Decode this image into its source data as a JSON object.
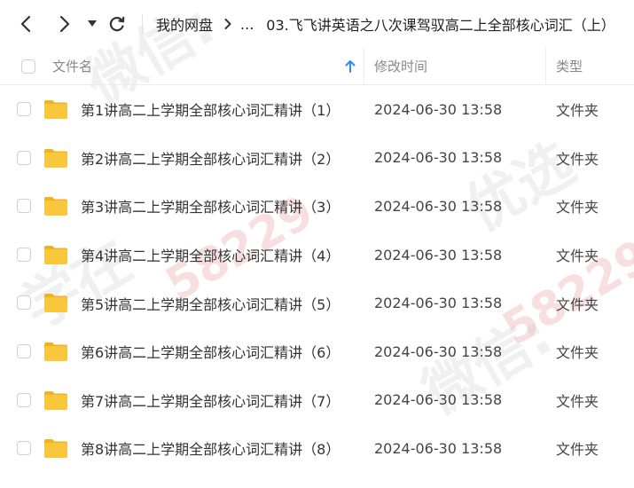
{
  "breadcrumb": {
    "root": "我的网盘",
    "ellipsis": "...",
    "current": "03.飞飞讲英语之八次课驾驭高二上全部核心词汇（上）"
  },
  "columns": {
    "name": "文件名",
    "modified": "修改时间",
    "type": "类型"
  },
  "files": [
    {
      "name": "第1讲高二上学期全部核心词汇精讲（1）",
      "modified": "2024-06-30 13:58",
      "type": "文件夹"
    },
    {
      "name": "第2讲高二上学期全部核心词汇精讲（2）",
      "modified": "2024-06-30 13:58",
      "type": "文件夹"
    },
    {
      "name": "第3讲高二上学期全部核心词汇精讲（3）",
      "modified": "2024-06-30 13:58",
      "type": "文件夹"
    },
    {
      "name": "第4讲高二上学期全部核心词汇精讲（4）",
      "modified": "2024-06-30 13:58",
      "type": "文件夹"
    },
    {
      "name": "第5讲高二上学期全部核心词汇精讲（5）",
      "modified": "2024-06-30 13:58",
      "type": "文件夹"
    },
    {
      "name": "第6讲高二上学期全部核心词汇精讲（6）",
      "modified": "2024-06-30 13:58",
      "type": "文件夹"
    },
    {
      "name": "第7讲高二上学期全部核心词汇精讲（7）",
      "modified": "2024-06-30 13:58",
      "type": "文件夹"
    },
    {
      "name": "第8讲高二上学期全部核心词汇精讲（8）",
      "modified": "2024-06-30 13:58",
      "type": "文件夹"
    }
  ],
  "watermark": {
    "text_a": "学在",
    "text_b": "优选",
    "text_c": "微信:",
    "number": "58229"
  },
  "colors": {
    "folder": "#F9C73C",
    "folder_tab": "#F2B21F",
    "sort_arrow": "#2E8BF0"
  },
  "icons": {
    "back": "chevron-left-icon",
    "forward": "chevron-right-icon",
    "dropdown": "caret-down-icon",
    "refresh": "refresh-icon",
    "folder": "folder-icon",
    "sort": "arrow-up-icon"
  }
}
